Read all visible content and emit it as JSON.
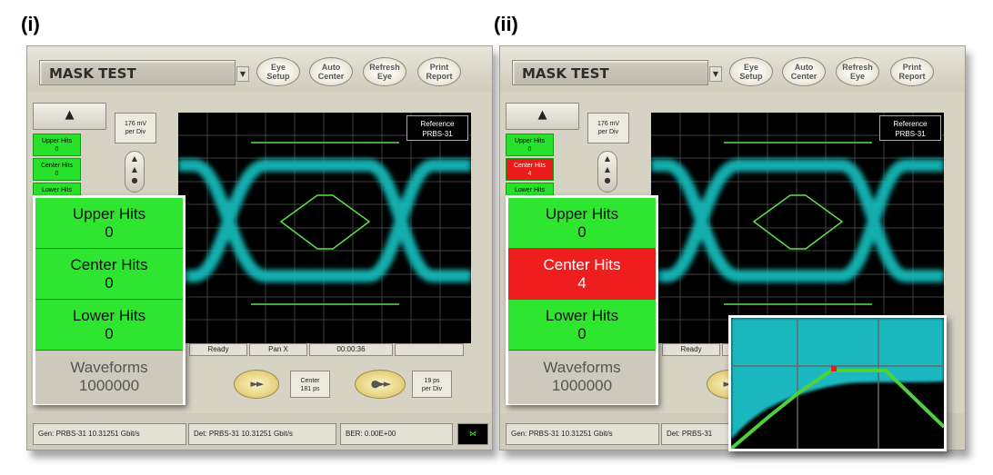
{
  "labels": {
    "left": "(i)",
    "right": "(ii)"
  },
  "panels": [
    {
      "title": "MASK TEST",
      "toolbar": [
        [
          "Eye",
          "Setup"
        ],
        [
          "Auto",
          "Center"
        ],
        [
          "Refresh",
          "Eye"
        ],
        [
          "Print",
          "Report"
        ]
      ],
      "scale_v": [
        "176 mV",
        "per Div"
      ],
      "hits_small": [
        {
          "label": "Upper Hits",
          "value": "0"
        },
        {
          "label": "Center Hits",
          "value": "0"
        },
        {
          "label": "Lower Hits",
          "value": ""
        }
      ],
      "reference": [
        "Reference",
        "PRBS-31"
      ],
      "status": [
        "Ready",
        "Pan X",
        "00:00:36",
        ""
      ],
      "center": [
        "Center",
        "181 ps"
      ],
      "scale_h": [
        "19 ps",
        "per Div"
      ],
      "gen": "Gen: PRBS-31 10.31251 Gbit/s",
      "det": "Det: PRBS-31 10.31251 Gbit/s",
      "ber": "BER: 0.00E+00",
      "hits_zoom": [
        {
          "label": "Upper Hits",
          "value": "0",
          "status": "green"
        },
        {
          "label": "Center Hits",
          "value": "0",
          "status": "green"
        },
        {
          "label": "Lower Hits",
          "value": "0",
          "status": "green"
        }
      ],
      "waveforms": {
        "label": "Waveforms",
        "value": "1000000"
      }
    },
    {
      "title": "MASK TEST",
      "toolbar": [
        [
          "Eye",
          "Setup"
        ],
        [
          "Auto",
          "Center"
        ],
        [
          "Refresh",
          "Eye"
        ],
        [
          "Print",
          "Report"
        ]
      ],
      "scale_v": [
        "176 mV",
        "per Div"
      ],
      "hits_small": [
        {
          "label": "Upper Hits",
          "value": "0"
        },
        {
          "label": "Center Hits",
          "value": "4"
        },
        {
          "label": "Lower Hits",
          "value": ""
        }
      ],
      "reference": [
        "Reference",
        "PRBS-31"
      ],
      "status": [
        "Ready"
      ],
      "gen": "Gen: PRBS-31 10.31251 Gbit/s",
      "det": "Det: PRBS-31",
      "hits_zoom": [
        {
          "label": "Upper Hits",
          "value": "0",
          "status": "green"
        },
        {
          "label": "Center Hits",
          "value": "4",
          "status": "red"
        },
        {
          "label": "Lower Hits",
          "value": "0",
          "status": "green"
        }
      ],
      "waveforms": {
        "label": "Waveforms",
        "value": "1000000"
      }
    }
  ],
  "colors": {
    "eye": "#12b4b4",
    "mask": "#5ee04a",
    "pass": "#2ee62f",
    "fail": "#ef1e1e"
  }
}
